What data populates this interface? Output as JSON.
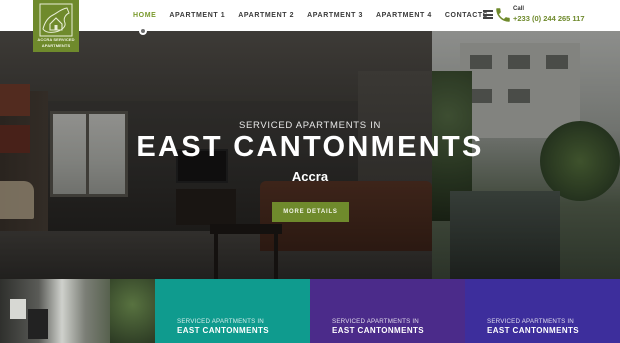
{
  "brand": {
    "logo_text_line1": "ACCRA SERVICED",
    "logo_text_line2": "APARTMENTS",
    "accent": "#6f8a2c"
  },
  "nav": {
    "items": [
      {
        "label": "HOME",
        "active": true
      },
      {
        "label": "APARTMENT 1",
        "active": false
      },
      {
        "label": "APARTMENT 2",
        "active": false
      },
      {
        "label": "APARTMENT 3",
        "active": false
      },
      {
        "label": "APARTMENT 4",
        "active": false
      },
      {
        "label": "CONTACTS",
        "active": false
      }
    ]
  },
  "contact": {
    "call_label": "Call",
    "phone": "+233 (0) 244 265 117"
  },
  "hero": {
    "subtitle": "SERVICED APARTMENTS IN",
    "title": "EAST CANTONMENTS",
    "city": "Accra",
    "button_label": "MORE DETAILS"
  },
  "tiles": [
    {
      "subtitle": "SERVICED APARTMENTS IN",
      "title": "EAST CANTONMENTS",
      "color": "#0f9b8e"
    },
    {
      "subtitle": "SERVICED APARTMENTS IN",
      "title": "EAST CANTONMENTS",
      "color": "#4b2b8a"
    },
    {
      "subtitle": "SERVICED APARTMENTS IN",
      "title": "EAST CANTONMENTS",
      "color": "#3d2e9c"
    }
  ],
  "icons": {
    "menu": "hamburger-icon",
    "phone": "phone-icon",
    "logo": "house-map-icon"
  }
}
